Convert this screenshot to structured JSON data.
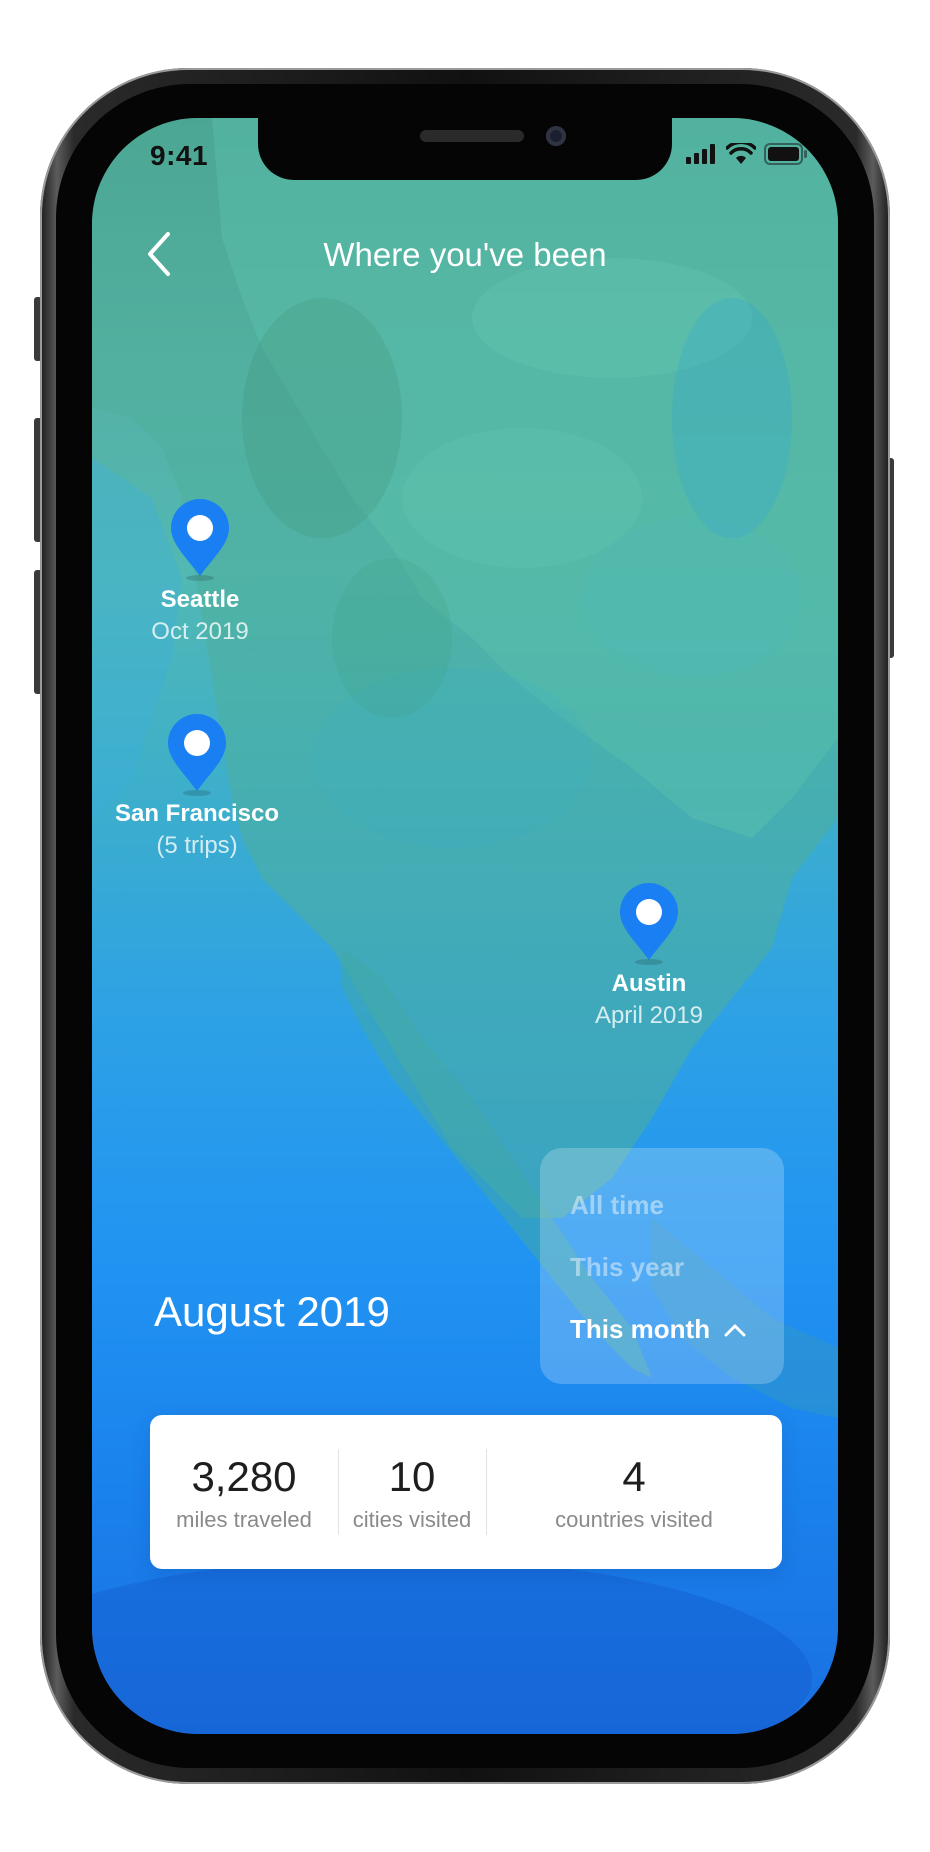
{
  "status_bar": {
    "time": "9:41",
    "icons": [
      "signal-icon",
      "wifi-icon",
      "battery-icon"
    ]
  },
  "header": {
    "title": "Where you've been",
    "back_icon": "chevron-left-icon"
  },
  "pins": [
    {
      "name": "Seattle",
      "subtitle": "Oct 2019"
    },
    {
      "name": "San Francisco",
      "subtitle": "(5 trips)"
    },
    {
      "name": "Austin",
      "subtitle": "April 2019"
    }
  ],
  "period_dropdown": {
    "options": [
      "All time",
      "This year",
      "This month"
    ],
    "selected": "This month"
  },
  "month_title": "August 2019",
  "stats": [
    {
      "value": "3,280",
      "label": "miles traveled"
    },
    {
      "value": "10",
      "label": "cities visited"
    },
    {
      "value": "4",
      "label": "countries visited"
    }
  ],
  "colors": {
    "pin": "#1a7ff2",
    "sea_top": "#4a9c8c",
    "sea_bottom": "#1a6fe0",
    "card": "#ffffff"
  }
}
